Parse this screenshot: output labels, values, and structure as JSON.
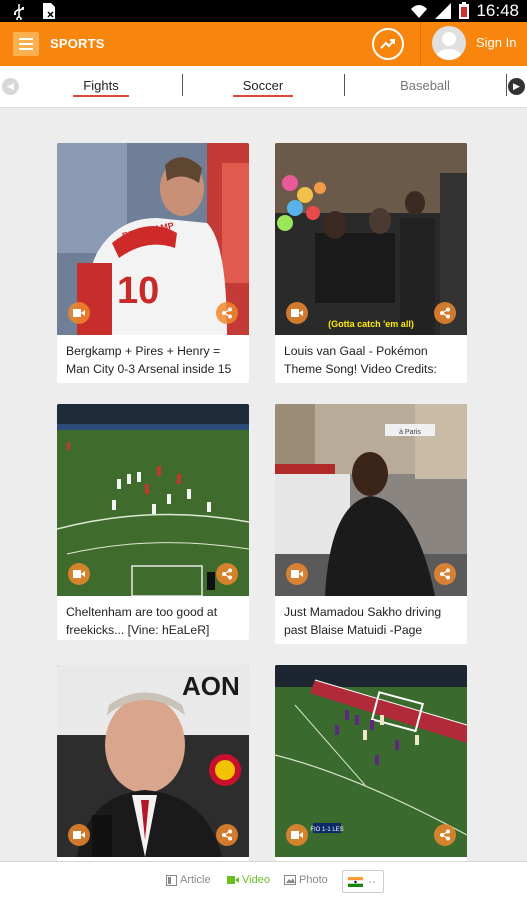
{
  "status_bar": {
    "time": "16:48"
  },
  "app_bar": {
    "title": "SPORTS",
    "sign_in": "Sign In"
  },
  "tabs": [
    {
      "label": "Fights",
      "active": true
    },
    {
      "label": "Soccer",
      "active": true
    },
    {
      "label": "Baseball",
      "active": false
    }
  ],
  "cards": [
    {
      "caption": "Bergkamp + Pires + Henry = Man City 0-3 Arsenal inside 15",
      "overlay_text": "BERGKAMP",
      "jersey_number": "10"
    },
    {
      "caption": "Louis van Gaal - Pokémon Theme Song! Video Credits:",
      "overlay_text": "(Gotta catch 'em all)"
    },
    {
      "caption": "Cheltenham are too good at freekicks... [Vine: hEaLeR]"
    },
    {
      "caption": "Just Mamadou Sakho driving past Blaise Matuidi -Page",
      "sign_text": "à Paris"
    },
    {
      "caption": "",
      "overlay_text": "AON"
    },
    {
      "caption": "",
      "scoreboard": "FIO 1-1 LES"
    }
  ],
  "bottom_bar": {
    "article": "Article",
    "video": "Video",
    "photo": "Photo"
  },
  "colors": {
    "brand_orange": "#f7850e",
    "active_tab_underline": "#e0473d",
    "active_bottom": "#6abf26",
    "badge": "#ef872d"
  },
  "icons": [
    "usb-icon",
    "sim-icon",
    "wifi-icon",
    "signal-icon",
    "battery-icon",
    "menu-icon",
    "trending-icon",
    "avatar-icon",
    "chevron-left-icon",
    "chevron-right-icon",
    "video-icon",
    "share-icon",
    "article-icon",
    "photo-icon",
    "flag-india-icon",
    "more-dots-icon"
  ]
}
